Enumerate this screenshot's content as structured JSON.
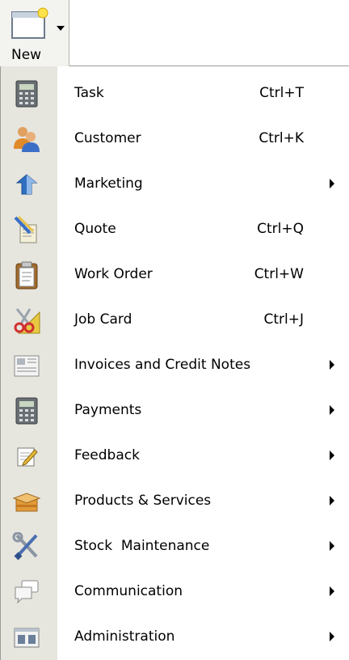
{
  "toolbar": {
    "new_label": "New",
    "new_icon": "new-document-icon"
  },
  "menu": {
    "items": [
      {
        "label": "Task",
        "shortcut": "Ctrl+T",
        "icon": "calculator-icon",
        "submenu": false
      },
      {
        "label": "Customer",
        "shortcut": "Ctrl+K",
        "icon": "people-icon",
        "submenu": false
      },
      {
        "label": "Marketing",
        "shortcut": "",
        "icon": "marketing-icon",
        "submenu": true
      },
      {
        "label": "Quote",
        "shortcut": "Ctrl+Q",
        "icon": "quote-icon",
        "submenu": false
      },
      {
        "label": "Work Order",
        "shortcut": "Ctrl+W",
        "icon": "clipboard-icon",
        "submenu": false
      },
      {
        "label": "Job Card",
        "shortcut": "Ctrl+J",
        "icon": "job-card-icon",
        "submenu": false
      },
      {
        "label": "Invoices and Credit Notes",
        "shortcut": "",
        "icon": "invoice-icon",
        "submenu": true
      },
      {
        "label": "Payments",
        "shortcut": "",
        "icon": "calculator-icon",
        "submenu": true
      },
      {
        "label": "Feedback",
        "shortcut": "",
        "icon": "notepad-icon",
        "submenu": true
      },
      {
        "label": "Products & Services",
        "shortcut": "",
        "icon": "box-icon",
        "submenu": true
      },
      {
        "label": "Stock  Maintenance",
        "shortcut": "",
        "icon": "tools-icon",
        "submenu": true
      },
      {
        "label": "Communication",
        "shortcut": "",
        "icon": "chat-icon",
        "submenu": true
      },
      {
        "label": "Administration",
        "shortcut": "",
        "icon": "admin-icon",
        "submenu": true
      }
    ]
  },
  "colors": {
    "gutter": "#e6e5de",
    "toolbar": "#f3f3f0",
    "accent_yellow": "#ffe34c"
  }
}
